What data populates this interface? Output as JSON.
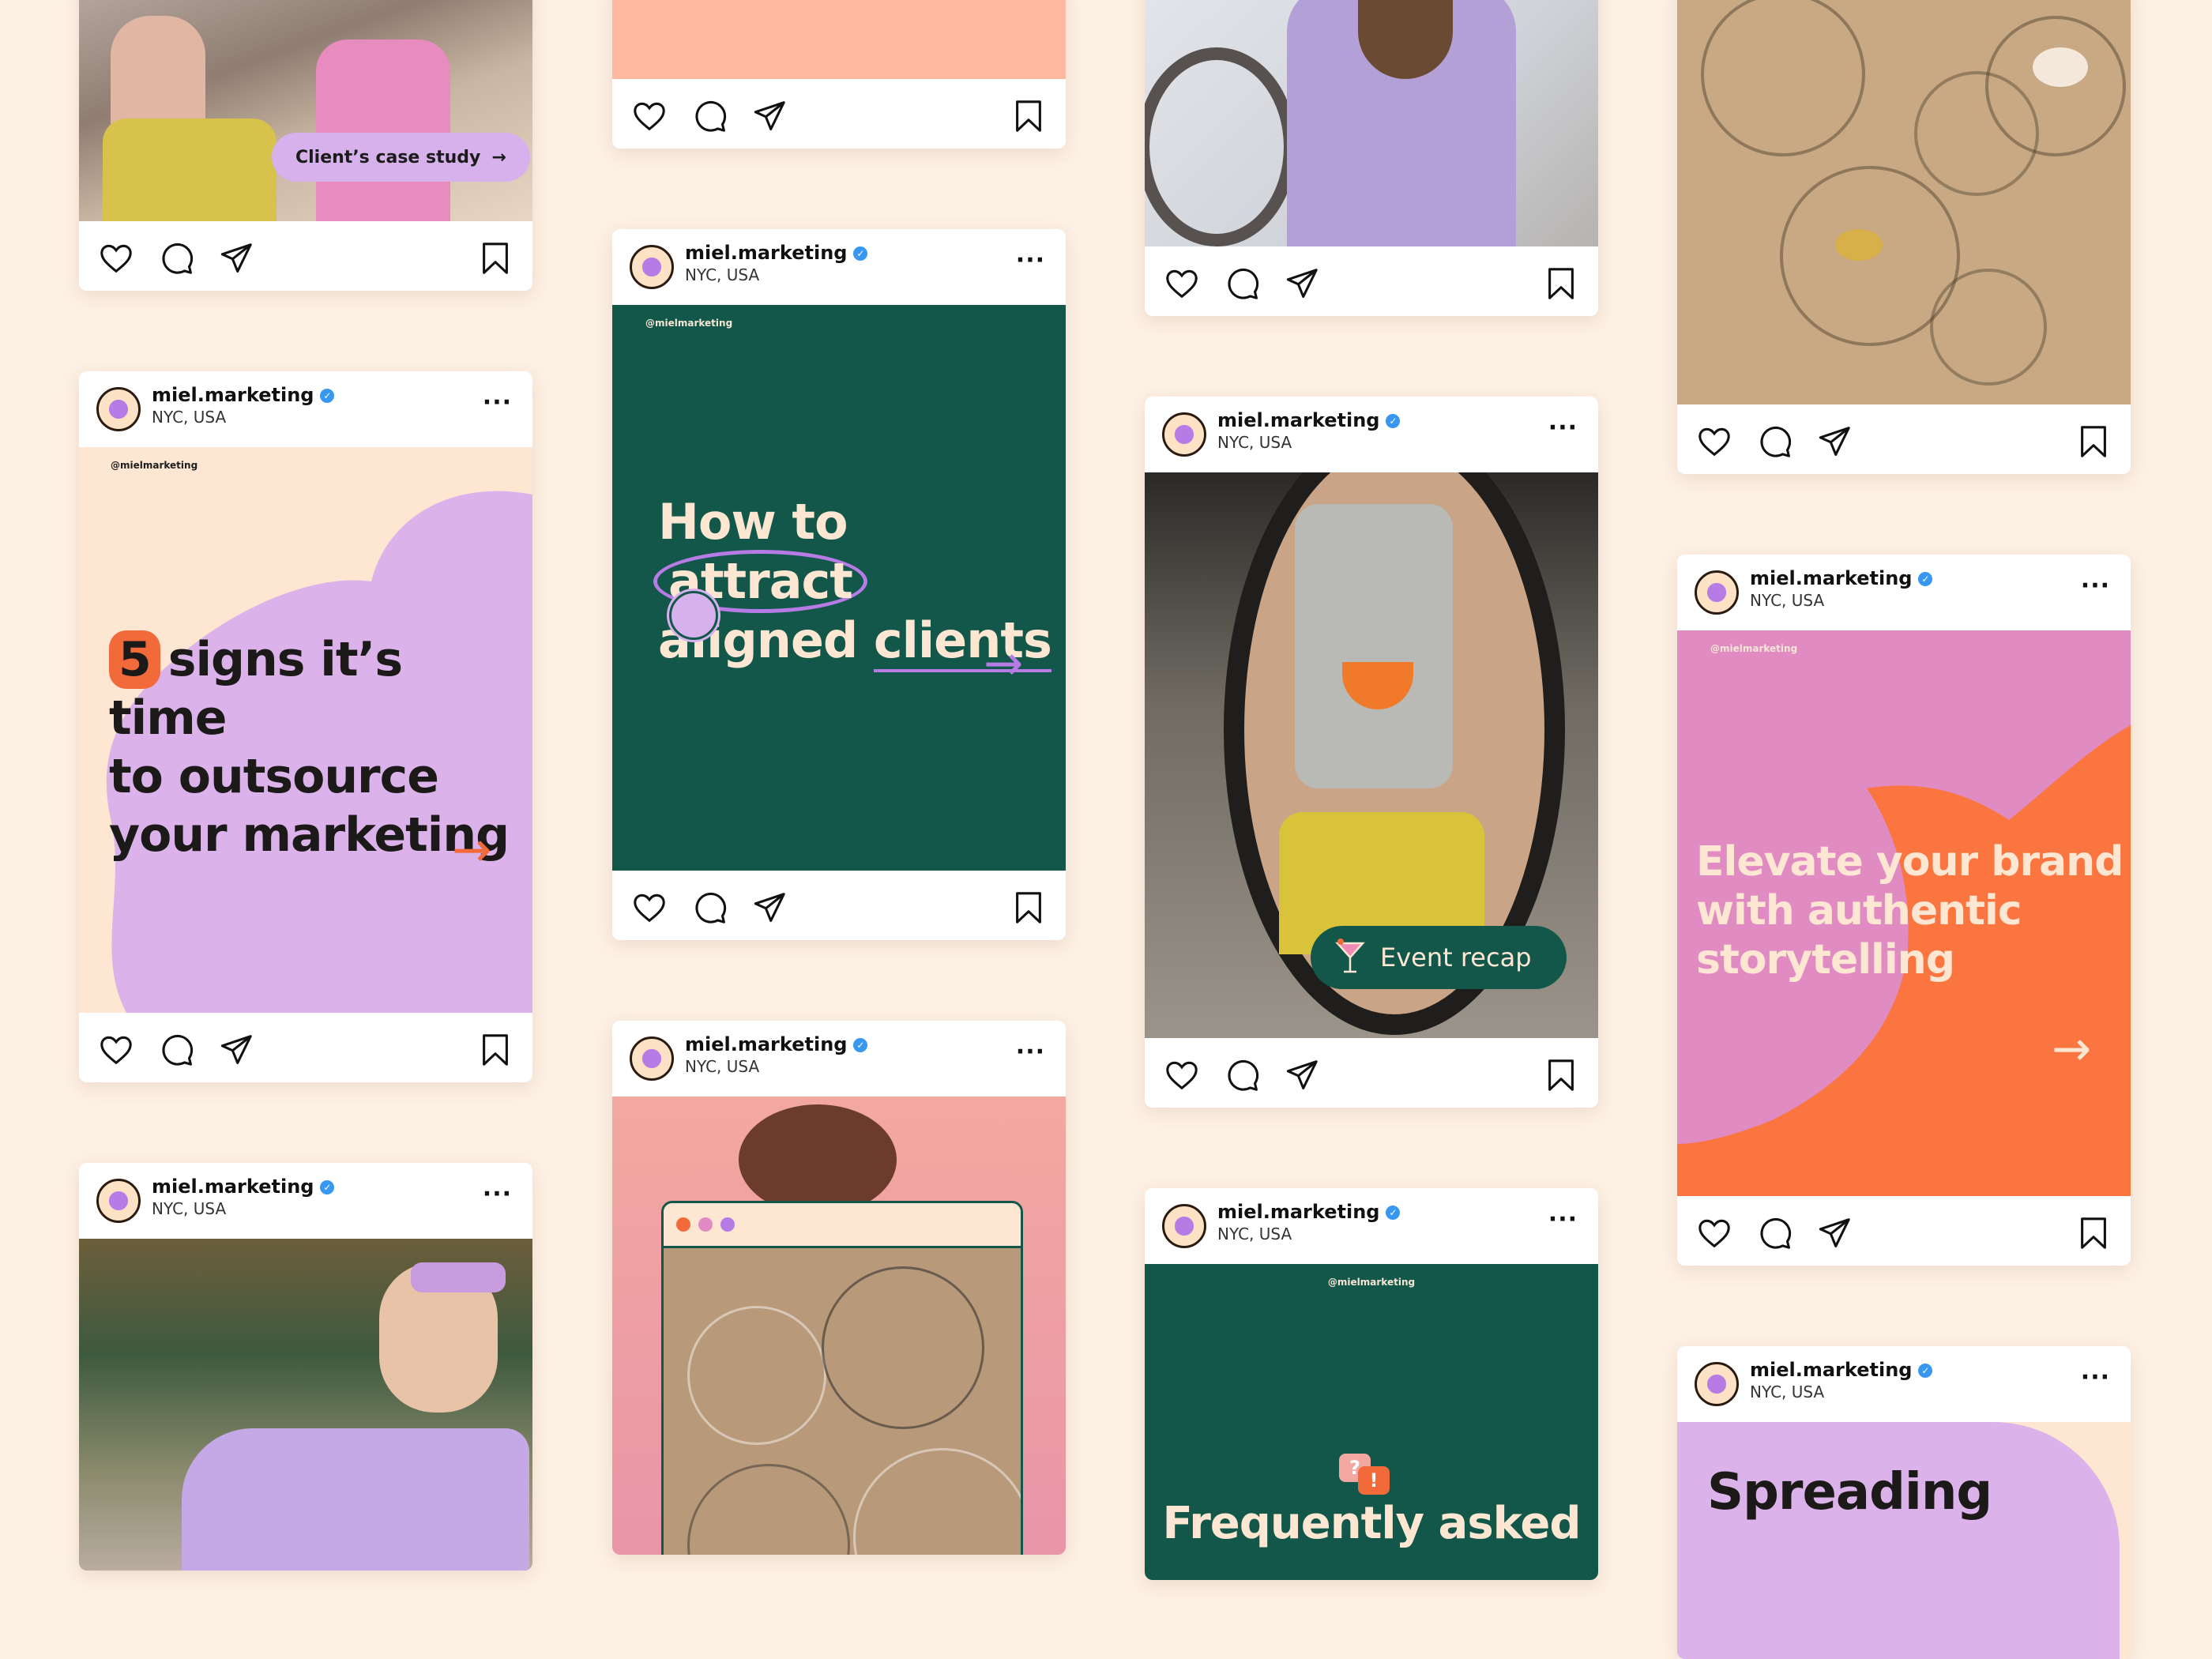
{
  "account": {
    "username": "miel.marketing",
    "location": "NYC, USA",
    "verified_mark": "✓",
    "more_label": "···"
  },
  "post_handle": "@mielmarketing",
  "colors": {
    "background": "#fdf0e4",
    "green": "#12574a",
    "lilac": "#dcb2ea",
    "orange": "#fb7540",
    "pink": "#e08cc2",
    "peach": "#fdb8a0",
    "cream": "#fde7d3"
  },
  "icons": [
    "heart-icon",
    "comment-icon",
    "share-icon",
    "bookmark-icon",
    "more-icon",
    "verified-icon",
    "arrow-right-icon",
    "cocktail-icon",
    "chat-bubbles-icon"
  ],
  "posts": {
    "case_study": {
      "tag": "Client’s case study",
      "tag_arrow": "→"
    },
    "five_signs": {
      "number": "5",
      "line1": "signs it’s time",
      "line2": "to outsource",
      "line3": "your marketing",
      "arrow": "→"
    },
    "attract": {
      "line1_a": "How to",
      "line1_b": "attract",
      "line2_a": "aligned",
      "line2_b": "clients",
      "arrow": "→"
    },
    "event_recap": {
      "label": "Event recap"
    },
    "elevate": {
      "line1": "Elevate your brand",
      "line2": "with authentic",
      "line3": "storytelling",
      "arrow": "→"
    },
    "faq": {
      "line1": "Frequently asked",
      "bubble_q": "?",
      "bubble_e": "!"
    },
    "spreading": {
      "line1": "Spreading"
    }
  }
}
